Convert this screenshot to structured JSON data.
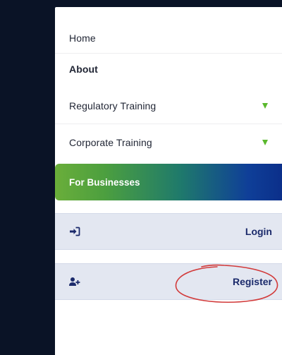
{
  "menu": {
    "home": "Home",
    "about": "About",
    "regulatory_training": "Regulatory Training",
    "corporate_training": "Corporate Training",
    "for_businesses": "For Businesses"
  },
  "actions": {
    "login": "Login",
    "register": "Register"
  },
  "icons": {
    "login": "sign-in-icon",
    "register": "user-plus-icon",
    "expand": "chevron-down-icon"
  },
  "colors": {
    "chevron": "#5ab82d",
    "action_text": "#1b2a6b",
    "annotation": "#d23a3a"
  }
}
